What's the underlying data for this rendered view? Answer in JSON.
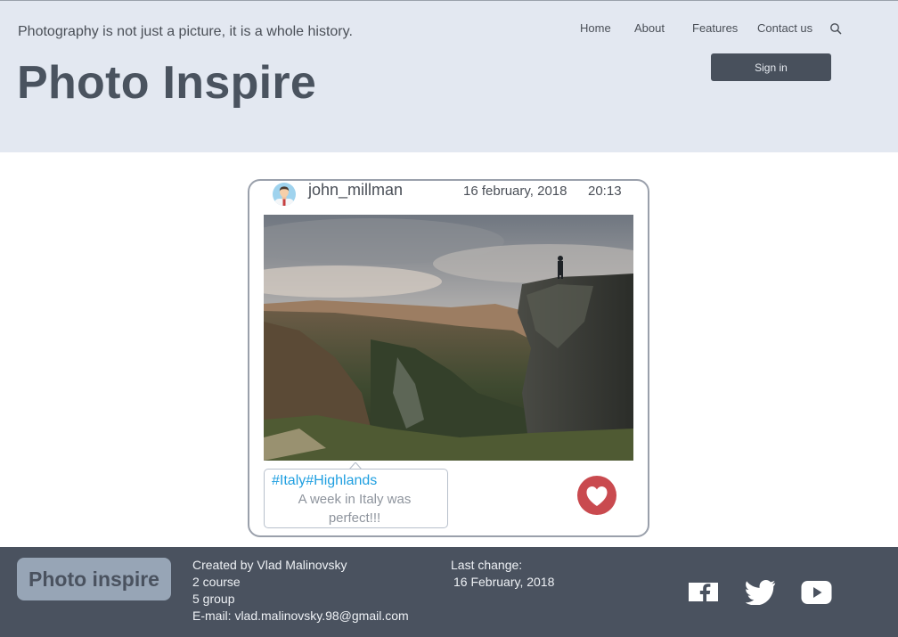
{
  "header": {
    "tagline": "Photography is not just a picture, it is a whole history.",
    "brand": "Photo Inspire",
    "nav": [
      "Home",
      "About",
      "Features",
      "Contact us"
    ],
    "signin_label": "Sign in"
  },
  "post": {
    "username": "john_millman",
    "date": "16 february, 2018",
    "time": "20:13",
    "hashtags": "#Italy#Highlands",
    "caption": "A week in Italy was perfect!!!"
  },
  "footer": {
    "brand": "Photo inspire",
    "created_by": "Created by Vlad Malinovsky",
    "course": "2 course",
    "group": "5 group",
    "email": "E-mail: vlad.malinovsky.98@gmail.com",
    "last_change_label": "Last change:",
    "last_change_date": "16 February, 2018"
  },
  "icons": {
    "search": "search-icon",
    "facebook": "facebook-icon",
    "twitter": "twitter-icon",
    "youtube": "youtube-icon",
    "like": "heart-icon"
  },
  "colors": {
    "header_bg": "#e3e8f1",
    "footer_bg": "#4a525f",
    "accent_dark": "#48505c",
    "hashtag": "#1f9fe0",
    "like": "#c94a4f"
  }
}
